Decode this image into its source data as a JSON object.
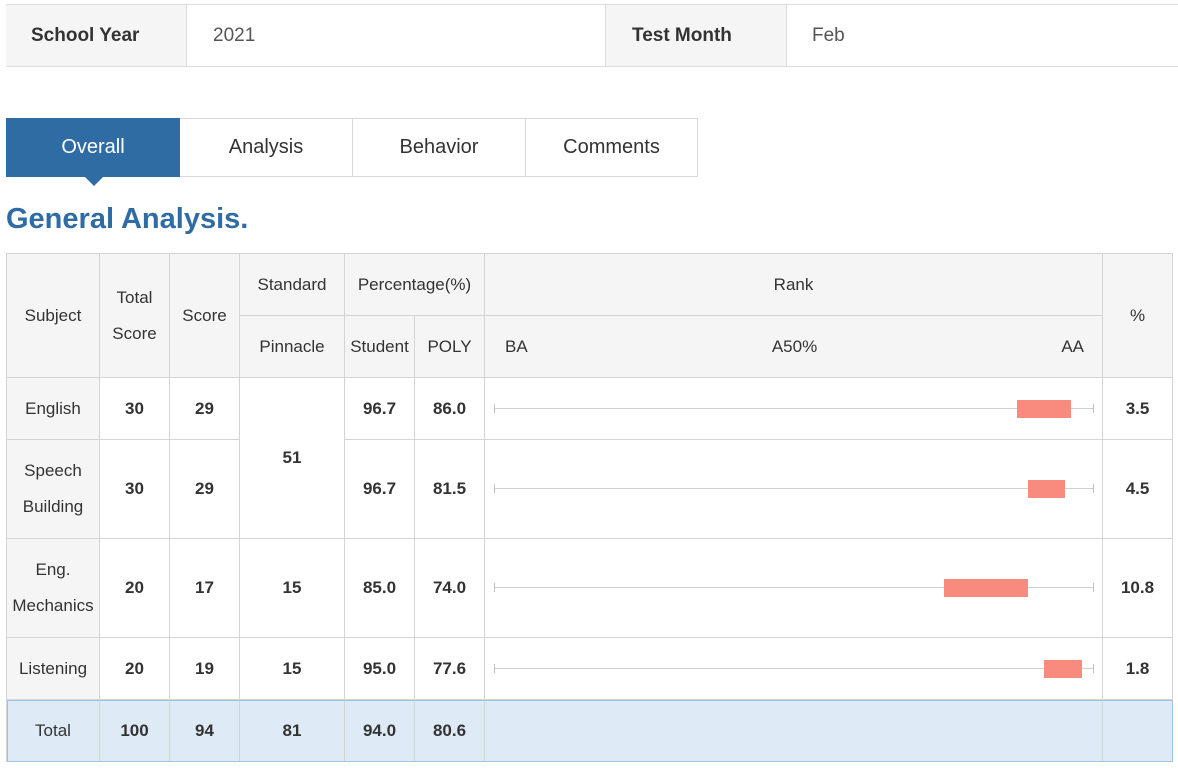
{
  "info": {
    "school_year_label": "School Year",
    "school_year_value": "2021",
    "test_month_label": "Test Month",
    "test_month_value": "Feb"
  },
  "tabs": [
    {
      "label": "Overall",
      "active": true
    },
    {
      "label": "Analysis",
      "active": false
    },
    {
      "label": "Behavior",
      "active": false
    },
    {
      "label": "Comments",
      "active": false
    }
  ],
  "section_title": "General Analysis.",
  "table": {
    "headers": {
      "subject": "Subject",
      "total_score_1": "Total",
      "total_score_2": "Score",
      "score": "Score",
      "standard": "Standard",
      "pinnacle": "Pinnacle",
      "percentage": "Percentage(%)",
      "student": "Student",
      "poly": "POLY",
      "rank": "Rank",
      "rank_ba": "BA",
      "rank_a50": "A50%",
      "rank_aa": "AA",
      "pct": "%"
    },
    "merged_standard": "51",
    "rows": [
      {
        "subject_1": "English",
        "subject_2": "",
        "total": "30",
        "score": "29",
        "student": "96.7",
        "poly": "86.0",
        "pct": "3.5",
        "rank_start": 0.872,
        "rank_end": 0.962
      },
      {
        "subject_1": "Speech",
        "subject_2": "Building",
        "total": "30",
        "score": "29",
        "student": "96.7",
        "poly": "81.5",
        "pct": "4.5",
        "rank_start": 0.89,
        "rank_end": 0.952
      },
      {
        "subject_1": "Eng.",
        "subject_2": "Mechanics",
        "total": "20",
        "score": "17",
        "standard": "15",
        "student": "85.0",
        "poly": "74.0",
        "pct": "10.8",
        "rank_start": 0.75,
        "rank_end": 0.89
      },
      {
        "subject_1": "Listening",
        "subject_2": "",
        "total": "20",
        "score": "19",
        "standard": "15",
        "student": "95.0",
        "poly": "77.6",
        "pct": "1.8",
        "rank_start": 0.917,
        "rank_end": 0.98
      }
    ],
    "total": {
      "label": "Total",
      "total": "100",
      "score": "94",
      "standard": "81",
      "student": "94.0",
      "poly": "80.6"
    }
  },
  "colors": {
    "accent": "#2f6ca3",
    "rank_bar": "#f88a7e",
    "total_row": "#deebf6"
  }
}
